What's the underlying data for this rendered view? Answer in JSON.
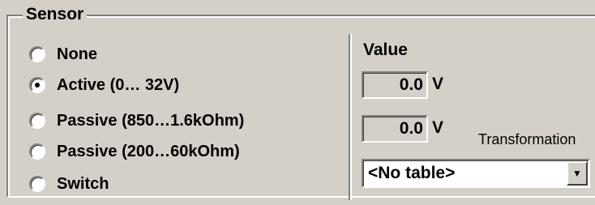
{
  "group": {
    "title": "Sensor"
  },
  "radios": [
    {
      "label": "None",
      "checked": false
    },
    {
      "label": "Active (0… 32V)",
      "checked": true
    },
    {
      "label": "Passive (850…1.6kOhm)",
      "checked": false
    },
    {
      "label": "Passive (200…60kOhm)",
      "checked": false
    },
    {
      "label": "Switch",
      "checked": false
    }
  ],
  "value_panel": {
    "label": "Value",
    "value1": "0.0",
    "unit1": "V",
    "value2": "0.0",
    "unit2": "V",
    "transformation_label": "Transformation",
    "table_selected": "<No table>"
  },
  "icons": {
    "dropdown": "chevron-down-icon"
  }
}
